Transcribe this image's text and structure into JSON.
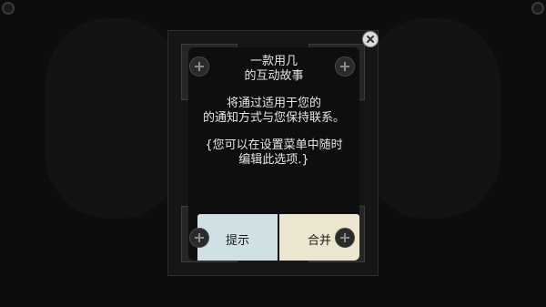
{
  "dialog": {
    "lines": [
      "一款用几",
      "的互动故事",
      "将通过适用于您的",
      "的通知方式与您保持联系。",
      "{您可以在设置菜单中随时",
      "编辑此选项.}"
    ],
    "buttons": {
      "left_label": "提示",
      "right_label": "合并"
    }
  },
  "icons": {
    "close": "close-icon",
    "screw": "screw-icon"
  }
}
